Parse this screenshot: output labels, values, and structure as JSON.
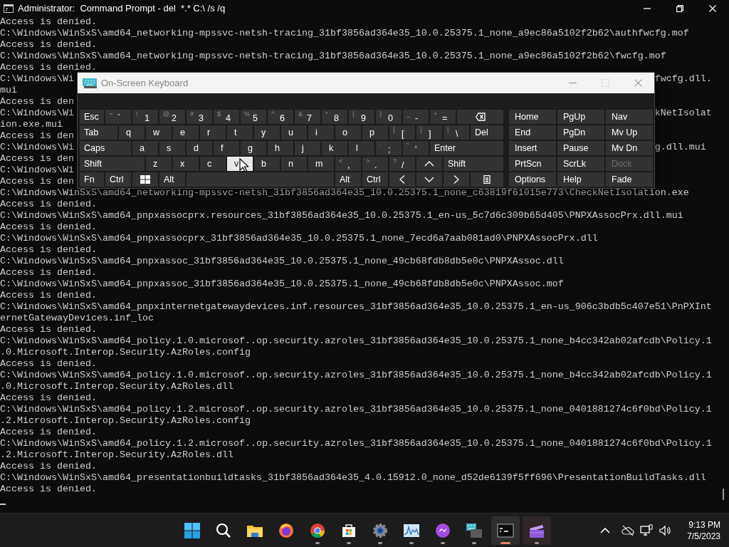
{
  "window": {
    "title": "Administrator:  Command Prompt - del  *.* C:\\ /s /q"
  },
  "console": {
    "lines": [
      {
        "text": "Access is denied."
      },
      {
        "text": "C:\\Windows\\WinSxS\\amd64_networking-mpssvc-netsh-tracing_31bf3856ad364e35_10.0.25375.1_none_a9ec86a5102f2b62\\authfwcfg.mof"
      },
      {
        "text": "Access is denied."
      },
      {
        "text": "C:\\Windows\\WinSxS\\amd64_networking-mpssvc-netsh-tracing_31bf3856ad364e35_10.0.25375.1_none_a9ec86a5102f2b62\\fwcfg.mof"
      },
      {
        "text": "Access is denied."
      },
      {
        "text": "C:\\Windows\\Wi",
        "tail": "fwcfg.dll."
      },
      {
        "text": "mui"
      },
      {
        "text": "Access is den"
      },
      {
        "text": "C:\\Windows\\Wi",
        "tail": "kNetIsolat"
      },
      {
        "text": "ion.exe.mui"
      },
      {
        "text": "Access is den"
      },
      {
        "text": "C:\\Windows\\Wi",
        "tail": "g.dll.mui"
      },
      {
        "text": "Access is den"
      },
      {
        "text": "C:\\Windows\\Wi"
      },
      {
        "text": "Access is den"
      },
      {
        "text": "C:\\Windows\\WinSxS\\amd64_networking-mpssvc-netsh_31bf3856ad364e35_10.0.25375.1_none_c63819f61015e773\\CheckNetIsolation.exe"
      },
      {
        "text": "Access is denied."
      },
      {
        "text": "C:\\Windows\\WinSxS\\amd64_pnpxassocprx.resources_31bf3856ad364e35_10.0.25375.1_en-us_5c7d6c309b65d405\\PNPXAssocPrx.dll.mui"
      },
      {
        "text": "Access is denied."
      },
      {
        "text": "C:\\Windows\\WinSxS\\amd64_pnpxassocprx_31bf3856ad364e35_10.0.25375.1_none_7ecd6a7aab081ad0\\PNPXAssocPrx.dll"
      },
      {
        "text": "Access is denied."
      },
      {
        "text": "C:\\Windows\\WinSxS\\amd64_pnpxassoc_31bf3856ad364e35_10.0.25375.1_none_49cb68fdb8db5e0c\\PNPXAssoc.dll"
      },
      {
        "text": "Access is denied."
      },
      {
        "text": "C:\\Windows\\WinSxS\\amd64_pnpxassoc_31bf3856ad364e35_10.0.25375.1_none_49cb68fdb8db5e0c\\PNPXAssoc.mof"
      },
      {
        "text": "Access is denied."
      },
      {
        "text": "C:\\Windows\\WinSxS\\amd64_pnpxinternetgatewaydevices.inf.resources_31bf3856ad364e35_10.0.25375.1_en-us_906c3bdb5c407e51\\PnPXInt"
      },
      {
        "text": "ernetGatewayDevices.inf_loc"
      },
      {
        "text": "Access is denied."
      },
      {
        "text": "C:\\Windows\\WinSxS\\amd64_policy.1.0.microsof..op.security.azroles_31bf3856ad364e35_10.0.25375.1_none_b4cc342ab02afcdb\\Policy.1"
      },
      {
        "text": ".0.Microsoft.Interop.Security.AzRoles.config"
      },
      {
        "text": "Access is denied."
      },
      {
        "text": "C:\\Windows\\WinSxS\\amd64_policy.1.0.microsof..op.security.azroles_31bf3856ad364e35_10.0.25375.1_none_b4cc342ab02afcdb\\Policy.1"
      },
      {
        "text": ".0.Microsoft.Interop.Security.AzRoles.dll"
      },
      {
        "text": "Access is denied."
      },
      {
        "text": "C:\\Windows\\WinSxS\\amd64_policy.1.2.microsof..op.security.azroles_31bf3856ad364e35_10.0.25375.1_none_0401881274c6f0bd\\Policy.1"
      },
      {
        "text": ".2.Microsoft.Interop.Security.AzRoles.config"
      },
      {
        "text": "Access is denied."
      },
      {
        "text": "C:\\Windows\\WinSxS\\amd64_policy.1.2.microsof..op.security.azroles_31bf3856ad364e35_10.0.25375.1_none_0401881274c6f0bd\\Policy.1"
      },
      {
        "text": ".2.Microsoft.Interop.Security.AzRoles.dll"
      },
      {
        "text": "Access is denied."
      },
      {
        "text": "C:\\Windows\\WinSxS\\amd64_presentationbuildtasks_31bf3856ad364e35_4.0.15912.0_none_d52de6139f5ff696\\PresentationBuildTasks.dll"
      },
      {
        "text": "Access is denied."
      }
    ]
  },
  "osk": {
    "title": "On-Screen Keyboard",
    "rows": [
      {
        "keys": [
          {
            "kind": "label",
            "text": "Esc",
            "hovered": false
          },
          {
            "kind": "char",
            "shift": "~",
            "main": "`",
            "hovered": false
          },
          {
            "kind": "char",
            "shift": "!",
            "main": "1",
            "hovered": false
          },
          {
            "kind": "char",
            "shift": "@",
            "main": "2",
            "hovered": false
          },
          {
            "kind": "char",
            "shift": "#",
            "main": "3",
            "hovered": false
          },
          {
            "kind": "char",
            "shift": "$",
            "main": "4",
            "hovered": false
          },
          {
            "kind": "char",
            "shift": "%",
            "main": "5",
            "hovered": false
          },
          {
            "kind": "char",
            "shift": "^",
            "main": "6",
            "hovered": false
          },
          {
            "kind": "char",
            "shift": "&",
            "main": "7",
            "hovered": false
          },
          {
            "kind": "char",
            "shift": "*",
            "main": "8",
            "hovered": false
          },
          {
            "kind": "char",
            "shift": "(",
            "main": "9",
            "hovered": false
          },
          {
            "kind": "char",
            "shift": ")",
            "main": "0",
            "hovered": false
          },
          {
            "kind": "char",
            "shift": "_",
            "main": "-",
            "hovered": false
          },
          {
            "kind": "char",
            "shift": "+",
            "main": "=",
            "hovered": false
          },
          {
            "kind": "backspace",
            "hovered": false
          }
        ]
      },
      {
        "keys": [
          {
            "kind": "label",
            "text": "Tab",
            "hovered": false
          },
          {
            "kind": "char",
            "main": "q",
            "hovered": false
          },
          {
            "kind": "char",
            "main": "w",
            "hovered": false
          },
          {
            "kind": "char",
            "main": "e",
            "hovered": false
          },
          {
            "kind": "char",
            "main": "r",
            "hovered": false
          },
          {
            "kind": "char",
            "main": "t",
            "hovered": false
          },
          {
            "kind": "char",
            "main": "y",
            "hovered": false
          },
          {
            "kind": "char",
            "main": "u",
            "hovered": false
          },
          {
            "kind": "char",
            "main": "i",
            "hovered": false
          },
          {
            "kind": "char",
            "main": "o",
            "hovered": false
          },
          {
            "kind": "char",
            "main": "p",
            "hovered": false
          },
          {
            "kind": "char",
            "shift": "{",
            "main": "[",
            "hovered": false
          },
          {
            "kind": "char",
            "shift": "}",
            "main": "]",
            "hovered": false
          },
          {
            "kind": "char",
            "shift": "|",
            "main": "\\",
            "hovered": false
          },
          {
            "kind": "label",
            "text": "Del",
            "hovered": false
          }
        ]
      },
      {
        "keys": [
          {
            "kind": "label",
            "text": "Caps",
            "hovered": false
          },
          {
            "kind": "char",
            "main": "a",
            "hovered": false
          },
          {
            "kind": "char",
            "main": "s",
            "hovered": false
          },
          {
            "kind": "char",
            "main": "d",
            "hovered": false
          },
          {
            "kind": "char",
            "main": "f",
            "hovered": false
          },
          {
            "kind": "char",
            "main": "g",
            "hovered": false
          },
          {
            "kind": "char",
            "main": "h",
            "hovered": false
          },
          {
            "kind": "char",
            "main": "j",
            "hovered": false
          },
          {
            "kind": "char",
            "main": "k",
            "hovered": false
          },
          {
            "kind": "char",
            "main": "l",
            "hovered": false
          },
          {
            "kind": "char",
            "shift": ":",
            "main": ";",
            "hovered": false
          },
          {
            "kind": "char",
            "shift": "\"",
            "main": "'",
            "hovered": false
          },
          {
            "kind": "label",
            "text": "Enter",
            "hovered": false
          }
        ]
      },
      {
        "keys": [
          {
            "kind": "label",
            "text": "Shift",
            "hovered": false
          },
          {
            "kind": "char",
            "main": "z",
            "hovered": false
          },
          {
            "kind": "char",
            "main": "x",
            "hovered": false
          },
          {
            "kind": "char",
            "main": "c",
            "hovered": false
          },
          {
            "kind": "char",
            "main": "v",
            "hovered": true
          },
          {
            "kind": "char",
            "main": "b",
            "hovered": false
          },
          {
            "kind": "char",
            "main": "n",
            "hovered": false
          },
          {
            "kind": "char",
            "main": "m",
            "hovered": false
          },
          {
            "kind": "char",
            "shift": "<",
            "main": ",",
            "hovered": false
          },
          {
            "kind": "char",
            "shift": ">",
            "main": ".",
            "hovered": false
          },
          {
            "kind": "char",
            "shift": "?",
            "main": "/",
            "hovered": false
          },
          {
            "kind": "up",
            "hovered": false
          },
          {
            "kind": "label",
            "text": "Shift",
            "hovered": false
          }
        ]
      },
      {
        "keys": [
          {
            "kind": "label",
            "text": "Fn",
            "hovered": false
          },
          {
            "kind": "label",
            "text": "Ctrl",
            "hovered": false
          },
          {
            "kind": "windows",
            "hovered": false
          },
          {
            "kind": "label",
            "text": "Alt",
            "hovered": false
          },
          {
            "kind": "space",
            "hovered": false
          },
          {
            "kind": "label",
            "text": "Alt",
            "hovered": false
          },
          {
            "kind": "label",
            "text": "Ctrl",
            "hovered": false
          },
          {
            "kind": "left",
            "hovered": false
          },
          {
            "kind": "down",
            "hovered": false
          },
          {
            "kind": "right",
            "hovered": false
          },
          {
            "kind": "menu",
            "hovered": false
          }
        ]
      }
    ],
    "nav_rows": [
      [
        {
          "text": "Home",
          "disabled": false
        },
        {
          "text": "PgUp",
          "disabled": false
        },
        {
          "text": "Nav",
          "disabled": false
        }
      ],
      [
        {
          "text": "End",
          "disabled": false
        },
        {
          "text": "PgDn",
          "disabled": false
        },
        {
          "text": "Mv Up",
          "disabled": false
        }
      ],
      [
        {
          "text": "Insert",
          "disabled": false
        },
        {
          "text": "Pause",
          "disabled": false
        },
        {
          "text": "Mv Dn",
          "disabled": false
        }
      ],
      [
        {
          "text": "PrtScn",
          "disabled": false
        },
        {
          "text": "ScrLk",
          "disabled": false
        },
        {
          "text": "Dock",
          "disabled": true
        }
      ],
      [
        {
          "text": "Options",
          "disabled": false
        },
        {
          "text": "Help",
          "disabled": false
        },
        {
          "text": "Fade",
          "disabled": false
        }
      ]
    ]
  },
  "taskbar": {
    "apps": [
      {
        "kind": "start",
        "running": false,
        "active": false,
        "hovered": false
      },
      {
        "kind": "search",
        "running": false,
        "active": false,
        "hovered": false
      },
      {
        "kind": "folder",
        "running": false,
        "active": false,
        "hovered": false
      },
      {
        "kind": "firefox",
        "running": false,
        "active": false,
        "hovered": false
      },
      {
        "kind": "chrome",
        "running": true,
        "active": false,
        "hovered": false
      },
      {
        "kind": "store",
        "running": true,
        "active": false,
        "hovered": false
      },
      {
        "kind": "settings",
        "running": true,
        "active": false,
        "hovered": false
      },
      {
        "kind": "chart",
        "running": true,
        "active": false,
        "hovered": false
      },
      {
        "kind": "messenger",
        "running": true,
        "active": false,
        "hovered": false
      },
      {
        "kind": "keyboard",
        "running": true,
        "active": false,
        "hovered": false
      },
      {
        "kind": "terminal",
        "running": true,
        "active": true,
        "hovered": false
      },
      {
        "kind": "clapper",
        "running": true,
        "active": false,
        "hovered": true
      }
    ],
    "tray": {
      "time": "9:13 PM",
      "date": "7/5/2023"
    }
  }
}
